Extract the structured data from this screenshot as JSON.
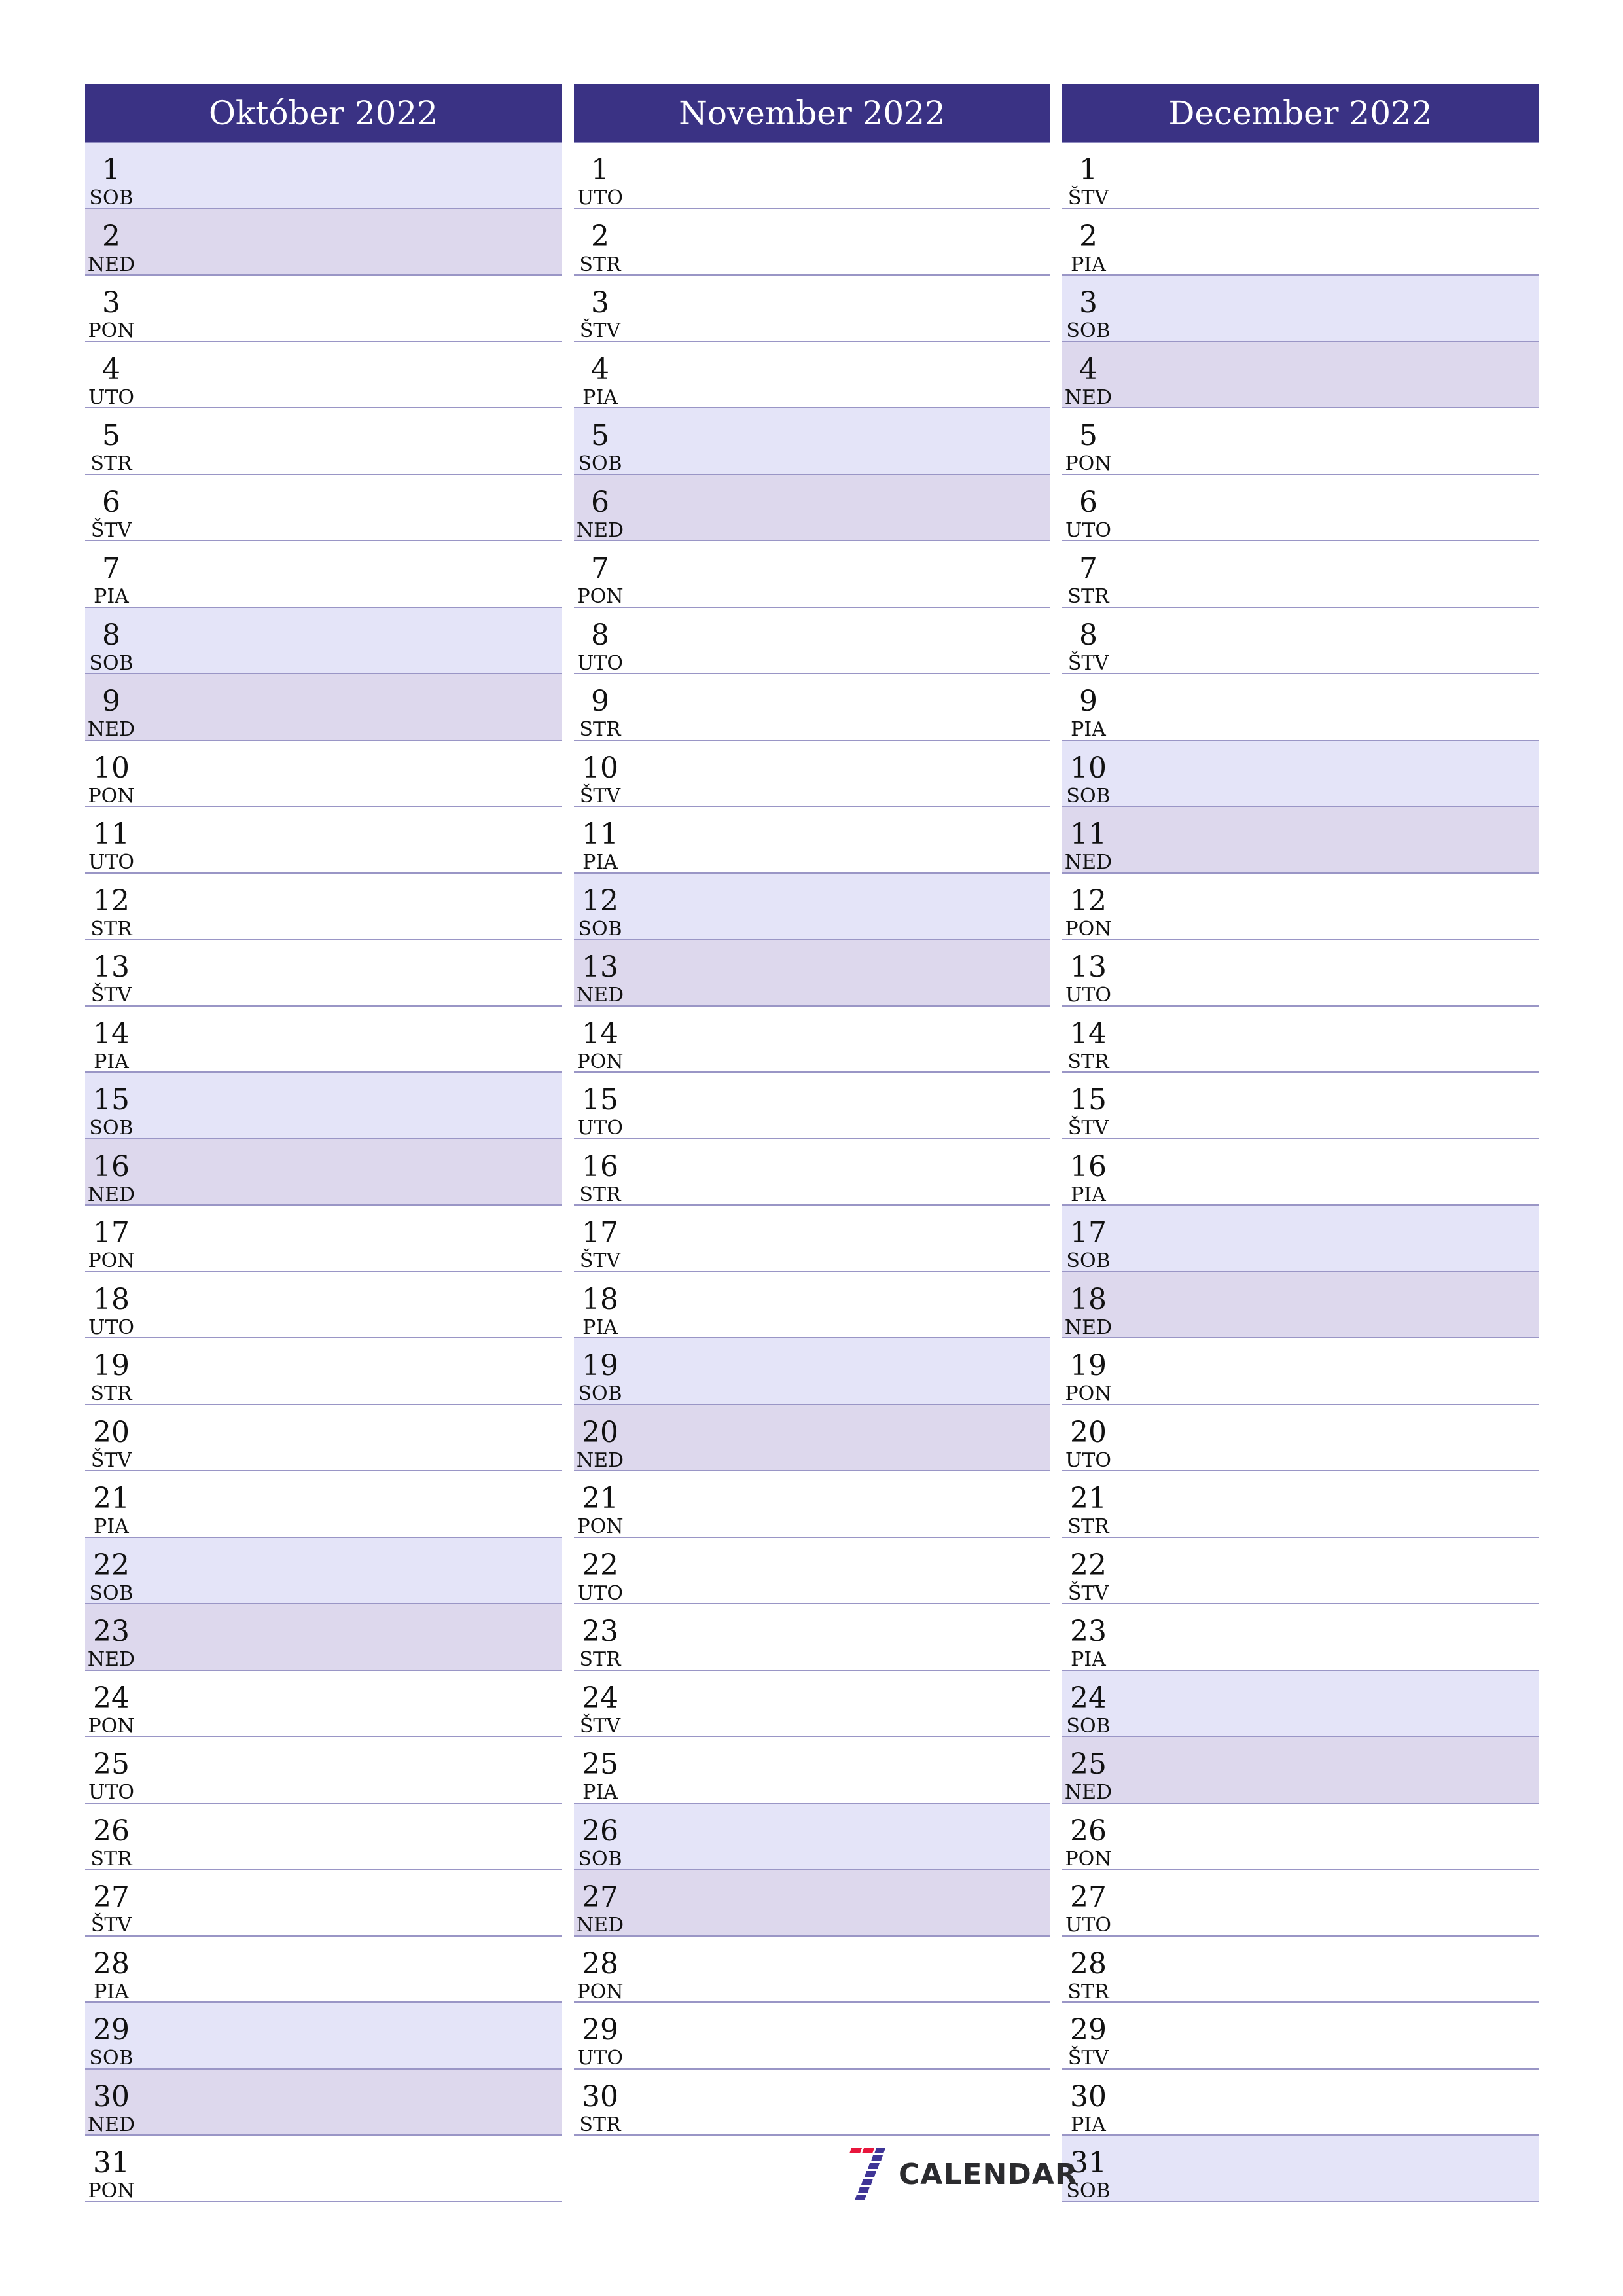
{
  "colors": {
    "header_bg": "#3a3284",
    "header_text": "#ffffff",
    "saturday_bg": "#e4e4f8",
    "sunday_bg": "#ddd8ed",
    "row_border": "#9a96c6",
    "logo_red": "#e8163c",
    "logo_blue": "#3f3596"
  },
  "months": [
    {
      "title": "Október 2022",
      "days": [
        {
          "num": "1",
          "name": "SOB",
          "type": "sat"
        },
        {
          "num": "2",
          "name": "NED",
          "type": "sun"
        },
        {
          "num": "3",
          "name": "PON",
          "type": ""
        },
        {
          "num": "4",
          "name": "UTO",
          "type": ""
        },
        {
          "num": "5",
          "name": "STR",
          "type": ""
        },
        {
          "num": "6",
          "name": "ŠTV",
          "type": ""
        },
        {
          "num": "7",
          "name": "PIA",
          "type": ""
        },
        {
          "num": "8",
          "name": "SOB",
          "type": "sat"
        },
        {
          "num": "9",
          "name": "NED",
          "type": "sun"
        },
        {
          "num": "10",
          "name": "PON",
          "type": ""
        },
        {
          "num": "11",
          "name": "UTO",
          "type": ""
        },
        {
          "num": "12",
          "name": "STR",
          "type": ""
        },
        {
          "num": "13",
          "name": "ŠTV",
          "type": ""
        },
        {
          "num": "14",
          "name": "PIA",
          "type": ""
        },
        {
          "num": "15",
          "name": "SOB",
          "type": "sat"
        },
        {
          "num": "16",
          "name": "NED",
          "type": "sun"
        },
        {
          "num": "17",
          "name": "PON",
          "type": ""
        },
        {
          "num": "18",
          "name": "UTO",
          "type": ""
        },
        {
          "num": "19",
          "name": "STR",
          "type": ""
        },
        {
          "num": "20",
          "name": "ŠTV",
          "type": ""
        },
        {
          "num": "21",
          "name": "PIA",
          "type": ""
        },
        {
          "num": "22",
          "name": "SOB",
          "type": "sat"
        },
        {
          "num": "23",
          "name": "NED",
          "type": "sun"
        },
        {
          "num": "24",
          "name": "PON",
          "type": ""
        },
        {
          "num": "25",
          "name": "UTO",
          "type": ""
        },
        {
          "num": "26",
          "name": "STR",
          "type": ""
        },
        {
          "num": "27",
          "name": "ŠTV",
          "type": ""
        },
        {
          "num": "28",
          "name": "PIA",
          "type": ""
        },
        {
          "num": "29",
          "name": "SOB",
          "type": "sat"
        },
        {
          "num": "30",
          "name": "NED",
          "type": "sun"
        },
        {
          "num": "31",
          "name": "PON",
          "type": ""
        }
      ]
    },
    {
      "title": "November 2022",
      "days": [
        {
          "num": "1",
          "name": "UTO",
          "type": ""
        },
        {
          "num": "2",
          "name": "STR",
          "type": ""
        },
        {
          "num": "3",
          "name": "ŠTV",
          "type": ""
        },
        {
          "num": "4",
          "name": "PIA",
          "type": ""
        },
        {
          "num": "5",
          "name": "SOB",
          "type": "sat"
        },
        {
          "num": "6",
          "name": "NED",
          "type": "sun"
        },
        {
          "num": "7",
          "name": "PON",
          "type": ""
        },
        {
          "num": "8",
          "name": "UTO",
          "type": ""
        },
        {
          "num": "9",
          "name": "STR",
          "type": ""
        },
        {
          "num": "10",
          "name": "ŠTV",
          "type": ""
        },
        {
          "num": "11",
          "name": "PIA",
          "type": ""
        },
        {
          "num": "12",
          "name": "SOB",
          "type": "sat"
        },
        {
          "num": "13",
          "name": "NED",
          "type": "sun"
        },
        {
          "num": "14",
          "name": "PON",
          "type": ""
        },
        {
          "num": "15",
          "name": "UTO",
          "type": ""
        },
        {
          "num": "16",
          "name": "STR",
          "type": ""
        },
        {
          "num": "17",
          "name": "ŠTV",
          "type": ""
        },
        {
          "num": "18",
          "name": "PIA",
          "type": ""
        },
        {
          "num": "19",
          "name": "SOB",
          "type": "sat"
        },
        {
          "num": "20",
          "name": "NED",
          "type": "sun"
        },
        {
          "num": "21",
          "name": "PON",
          "type": ""
        },
        {
          "num": "22",
          "name": "UTO",
          "type": ""
        },
        {
          "num": "23",
          "name": "STR",
          "type": ""
        },
        {
          "num": "24",
          "name": "ŠTV",
          "type": ""
        },
        {
          "num": "25",
          "name": "PIA",
          "type": ""
        },
        {
          "num": "26",
          "name": "SOB",
          "type": "sat"
        },
        {
          "num": "27",
          "name": "NED",
          "type": "sun"
        },
        {
          "num": "28",
          "name": "PON",
          "type": ""
        },
        {
          "num": "29",
          "name": "UTO",
          "type": ""
        },
        {
          "num": "30",
          "name": "STR",
          "type": ""
        }
      ]
    },
    {
      "title": "December 2022",
      "days": [
        {
          "num": "1",
          "name": "ŠTV",
          "type": ""
        },
        {
          "num": "2",
          "name": "PIA",
          "type": ""
        },
        {
          "num": "3",
          "name": "SOB",
          "type": "sat"
        },
        {
          "num": "4",
          "name": "NED",
          "type": "sun"
        },
        {
          "num": "5",
          "name": "PON",
          "type": ""
        },
        {
          "num": "6",
          "name": "UTO",
          "type": ""
        },
        {
          "num": "7",
          "name": "STR",
          "type": ""
        },
        {
          "num": "8",
          "name": "ŠTV",
          "type": ""
        },
        {
          "num": "9",
          "name": "PIA",
          "type": ""
        },
        {
          "num": "10",
          "name": "SOB",
          "type": "sat"
        },
        {
          "num": "11",
          "name": "NED",
          "type": "sun"
        },
        {
          "num": "12",
          "name": "PON",
          "type": ""
        },
        {
          "num": "13",
          "name": "UTO",
          "type": ""
        },
        {
          "num": "14",
          "name": "STR",
          "type": ""
        },
        {
          "num": "15",
          "name": "ŠTV",
          "type": ""
        },
        {
          "num": "16",
          "name": "PIA",
          "type": ""
        },
        {
          "num": "17",
          "name": "SOB",
          "type": "sat"
        },
        {
          "num": "18",
          "name": "NED",
          "type": "sun"
        },
        {
          "num": "19",
          "name": "PON",
          "type": ""
        },
        {
          "num": "20",
          "name": "UTO",
          "type": ""
        },
        {
          "num": "21",
          "name": "STR",
          "type": ""
        },
        {
          "num": "22",
          "name": "ŠTV",
          "type": ""
        },
        {
          "num": "23",
          "name": "PIA",
          "type": ""
        },
        {
          "num": "24",
          "name": "SOB",
          "type": "sat"
        },
        {
          "num": "25",
          "name": "NED",
          "type": "sun"
        },
        {
          "num": "26",
          "name": "PON",
          "type": ""
        },
        {
          "num": "27",
          "name": "UTO",
          "type": ""
        },
        {
          "num": "28",
          "name": "STR",
          "type": ""
        },
        {
          "num": "29",
          "name": "ŠTV",
          "type": ""
        },
        {
          "num": "30",
          "name": "PIA",
          "type": ""
        },
        {
          "num": "31",
          "name": "SOB",
          "type": "sat"
        }
      ]
    }
  ],
  "logo": {
    "icon": "seven-calendar-logo-icon",
    "text": "CALENDAR"
  }
}
